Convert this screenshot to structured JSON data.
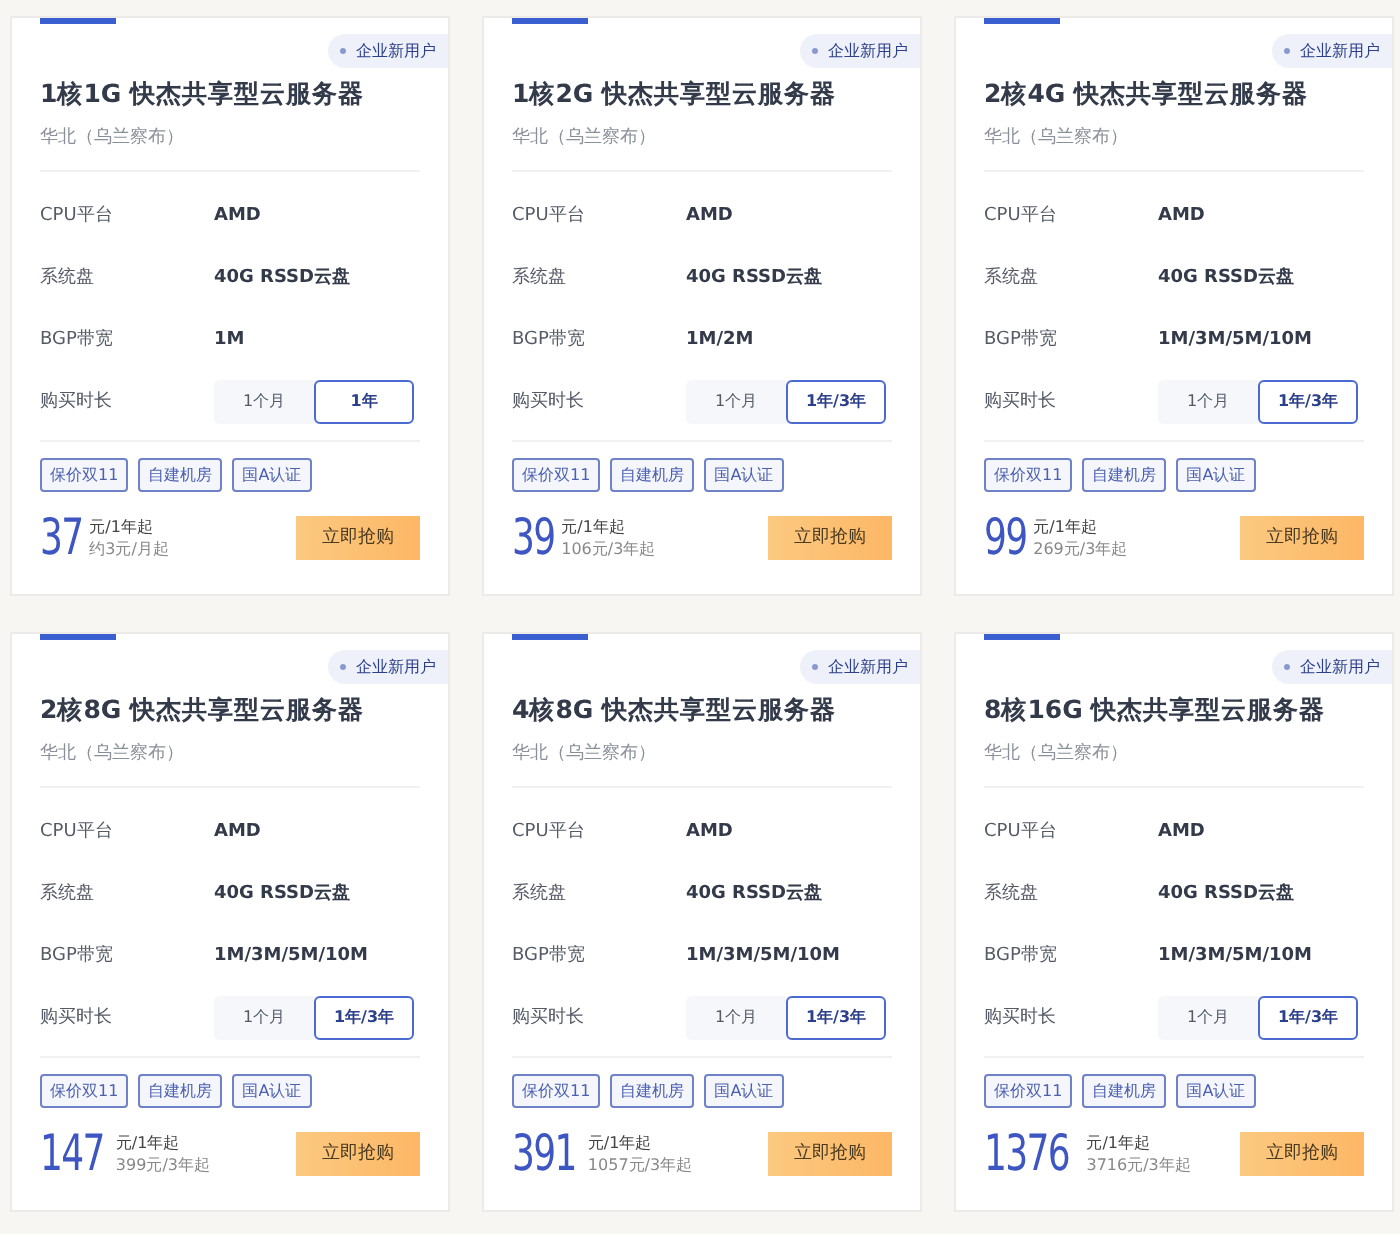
{
  "cards": [
    {
      "badge": "企业新用户",
      "title": "1核1G 快杰共享型云服务器",
      "region": "华北（乌兰察布）",
      "specs": [
        {
          "label": "CPU平台",
          "value": "AMD"
        },
        {
          "label": "系统盘",
          "value": "40G RSSD云盘"
        },
        {
          "label": "BGP带宽",
          "value": "1M"
        }
      ],
      "duration_label": "购买时长",
      "durations": [
        {
          "label": "1个月",
          "selected": false
        },
        {
          "label": "1年",
          "selected": true
        }
      ],
      "tags": [
        "保价双11",
        "自建机房",
        "国A认证"
      ],
      "price": "37",
      "price_unit": "元/1年起",
      "price_note": "约3元/月起",
      "button": "立即抢购"
    },
    {
      "badge": "企业新用户",
      "title": "1核2G 快杰共享型云服务器",
      "region": "华北（乌兰察布）",
      "specs": [
        {
          "label": "CPU平台",
          "value": "AMD"
        },
        {
          "label": "系统盘",
          "value": "40G RSSD云盘"
        },
        {
          "label": "BGP带宽",
          "value": "1M/2M"
        }
      ],
      "duration_label": "购买时长",
      "durations": [
        {
          "label": "1个月",
          "selected": false
        },
        {
          "label": "1年/3年",
          "selected": true
        }
      ],
      "tags": [
        "保价双11",
        "自建机房",
        "国A认证"
      ],
      "price": "39",
      "price_unit": "元/1年起",
      "price_note": "106元/3年起",
      "button": "立即抢购"
    },
    {
      "badge": "企业新用户",
      "title": "2核4G 快杰共享型云服务器",
      "region": "华北（乌兰察布）",
      "specs": [
        {
          "label": "CPU平台",
          "value": "AMD"
        },
        {
          "label": "系统盘",
          "value": "40G RSSD云盘"
        },
        {
          "label": "BGP带宽",
          "value": "1M/3M/5M/10M"
        }
      ],
      "duration_label": "购买时长",
      "durations": [
        {
          "label": "1个月",
          "selected": false
        },
        {
          "label": "1年/3年",
          "selected": true
        }
      ],
      "tags": [
        "保价双11",
        "自建机房",
        "国A认证"
      ],
      "price": "99",
      "price_unit": "元/1年起",
      "price_note": "269元/3年起",
      "button": "立即抢购"
    },
    {
      "badge": "企业新用户",
      "title": "2核8G 快杰共享型云服务器",
      "region": "华北（乌兰察布）",
      "specs": [
        {
          "label": "CPU平台",
          "value": "AMD"
        },
        {
          "label": "系统盘",
          "value": "40G RSSD云盘"
        },
        {
          "label": "BGP带宽",
          "value": "1M/3M/5M/10M"
        }
      ],
      "duration_label": "购买时长",
      "durations": [
        {
          "label": "1个月",
          "selected": false
        },
        {
          "label": "1年/3年",
          "selected": true
        }
      ],
      "tags": [
        "保价双11",
        "自建机房",
        "国A认证"
      ],
      "price": "147",
      "price_unit": "元/1年起",
      "price_note": "399元/3年起",
      "button": "立即抢购"
    },
    {
      "badge": "企业新用户",
      "title": "4核8G 快杰共享型云服务器",
      "region": "华北（乌兰察布）",
      "specs": [
        {
          "label": "CPU平台",
          "value": "AMD"
        },
        {
          "label": "系统盘",
          "value": "40G RSSD云盘"
        },
        {
          "label": "BGP带宽",
          "value": "1M/3M/5M/10M"
        }
      ],
      "duration_label": "购买时长",
      "durations": [
        {
          "label": "1个月",
          "selected": false
        },
        {
          "label": "1年/3年",
          "selected": true
        }
      ],
      "tags": [
        "保价双11",
        "自建机房",
        "国A认证"
      ],
      "price": "391",
      "price_unit": "元/1年起",
      "price_note": "1057元/3年起",
      "button": "立即抢购"
    },
    {
      "badge": "企业新用户",
      "title": "8核16G 快杰共享型云服务器",
      "region": "华北（乌兰察布）",
      "specs": [
        {
          "label": "CPU平台",
          "value": "AMD"
        },
        {
          "label": "系统盘",
          "value": "40G RSSD云盘"
        },
        {
          "label": "BGP带宽",
          "value": "1M/3M/5M/10M"
        }
      ],
      "duration_label": "购买时长",
      "durations": [
        {
          "label": "1个月",
          "selected": false
        },
        {
          "label": "1年/3年",
          "selected": true
        }
      ],
      "tags": [
        "保价双11",
        "自建机房",
        "国A认证"
      ],
      "price": "1376",
      "price_unit": "元/1年起",
      "price_note": "3716元/3年起",
      "button": "立即抢购"
    }
  ]
}
